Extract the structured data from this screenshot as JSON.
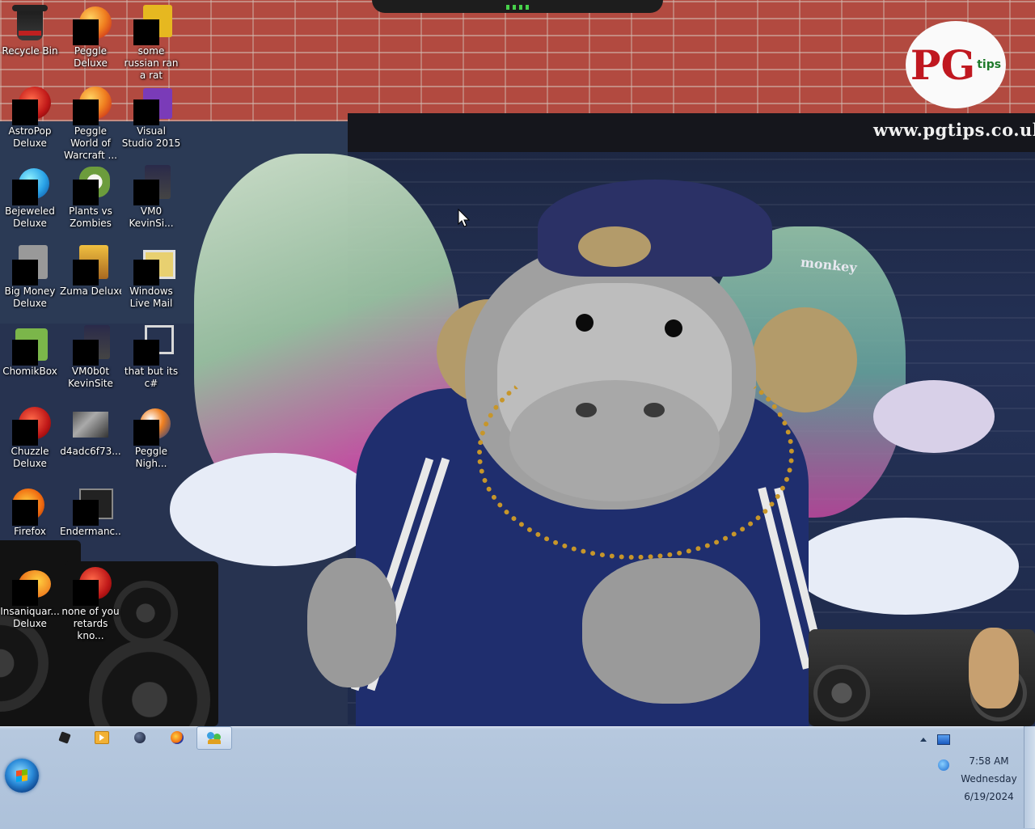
{
  "wallpaper": {
    "brand_logo": "PG",
    "brand_logo_small": "tips",
    "brand_url": "www.pgtips.co.uk",
    "graffiti_tag": "monkey"
  },
  "desktop": {
    "icons": [
      {
        "label": "Recycle Bin",
        "icon": "recycle-bin-icon"
      },
      {
        "label": "Peggle Deluxe",
        "icon": "peggle-icon"
      },
      {
        "label": "some russian ran a rat",
        "icon": "app-icon"
      },
      {
        "label": "AstroPop Deluxe",
        "icon": "astropop-icon"
      },
      {
        "label": "Peggle World of Warcraft ...",
        "icon": "peggle-wow-icon"
      },
      {
        "label": "Visual Studio 2015",
        "icon": "visual-studio-icon"
      },
      {
        "label": "Bejeweled Deluxe",
        "icon": "bejeweled-icon"
      },
      {
        "label": "Plants vs Zombies",
        "icon": "plants-vs-zombies-icon"
      },
      {
        "label": "VM0 KevinSi...",
        "icon": "vm-icon"
      },
      {
        "label": "Big Money Deluxe",
        "icon": "big-money-icon"
      },
      {
        "label": "Zuma Deluxe",
        "icon": "zuma-icon"
      },
      {
        "label": "Windows Live Mail",
        "icon": "windows-live-mail-icon"
      },
      {
        "label": "ChomikBox",
        "icon": "chomikbox-icon"
      },
      {
        "label": "VM0b0t KevinSite",
        "icon": "vm-bot-icon"
      },
      {
        "label": "that but its c#",
        "icon": "shortcut-icon"
      },
      {
        "label": "Chuzzle Deluxe",
        "icon": "chuzzle-icon"
      },
      {
        "label": "d4adc6f73...",
        "icon": "image-file-icon"
      },
      {
        "label": "Peggle Nigh...",
        "icon": "peggle-nights-icon"
      },
      {
        "label": "Firefox",
        "icon": "firefox-icon"
      },
      {
        "label": "Endermanc...",
        "icon": "endermanch-icon"
      },
      {
        "label": "Insaniquar... Deluxe",
        "icon": "insaniquarium-icon"
      },
      {
        "label": "none of you retards kno...",
        "icon": "app-icon"
      }
    ]
  },
  "taskbar": {
    "start_icon": "windows-start-orb-icon",
    "pinned": [
      {
        "name": "cube-app-icon"
      },
      {
        "name": "media-player-icon"
      },
      {
        "name": "dark-orb-app-icon"
      },
      {
        "name": "firefox-icon"
      },
      {
        "name": "contacts-app-icon",
        "active": true
      }
    ],
    "tray": {
      "show_hidden_icon": "chevron-up-icon",
      "icons": [
        "monitor-icon",
        "network-icon"
      ]
    },
    "clock": {
      "time": "7:58 AM",
      "day": "Wednesday",
      "date": "6/19/2024"
    }
  }
}
